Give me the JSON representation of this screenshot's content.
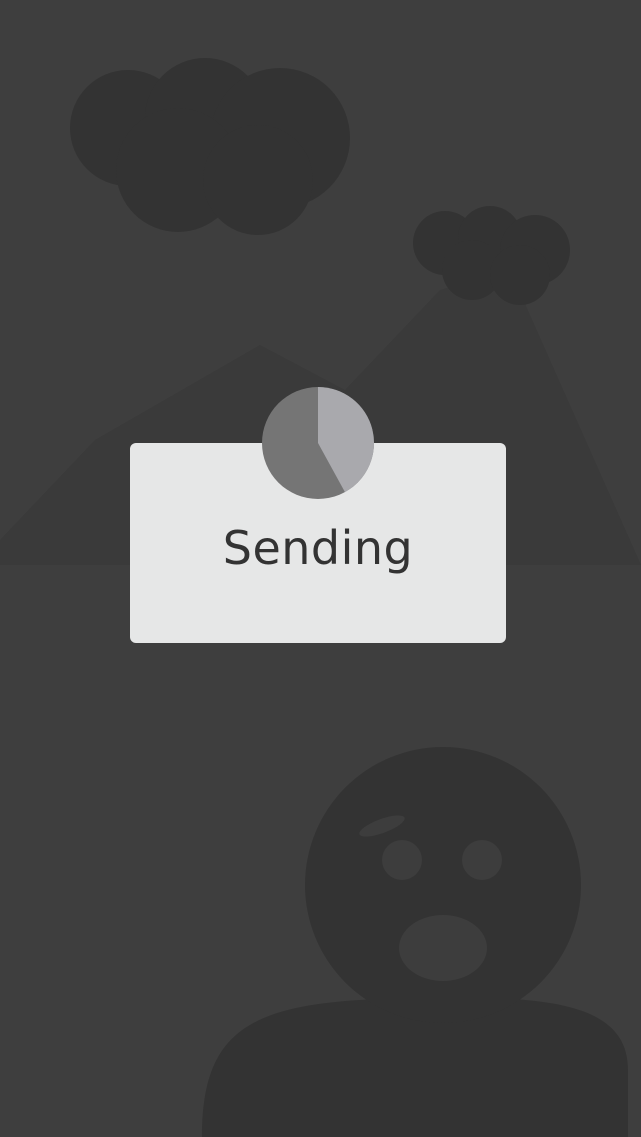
{
  "dialog": {
    "label": "Sending"
  },
  "progress": {
    "fraction": 0.42,
    "filled_color": "#a9a9ad",
    "track_color": "#757575"
  },
  "colors": {
    "background": "#3e3e3e",
    "illustration": "#333333",
    "illustration_light": "#3a3a3a",
    "face_detail": "#3d3d3d",
    "dialog_background": "#e6e7e7",
    "text": "#333333"
  },
  "icons": {
    "progress": "pie-progress-icon",
    "background": "illustration-clouds-mountains-character"
  }
}
